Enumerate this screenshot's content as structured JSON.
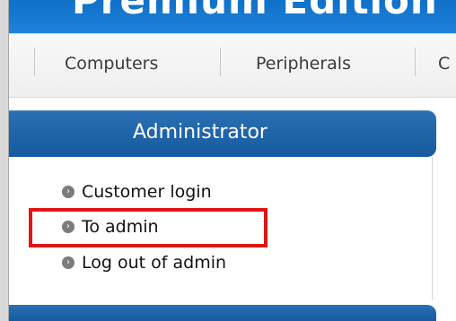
{
  "banner": {
    "title": "Premium Edition"
  },
  "nav": {
    "items": [
      "Computers",
      "Peripherals",
      "C"
    ]
  },
  "admin": {
    "title": "Administrator",
    "links": [
      {
        "label": "Customer login"
      },
      {
        "label": "To admin"
      },
      {
        "label": "Log out of admin"
      }
    ]
  },
  "icons": {
    "bullet": "chevron-circle-icon"
  },
  "colors": {
    "banner": "#1a78d2",
    "header": "#1f65aa",
    "highlight": "#e01515"
  }
}
